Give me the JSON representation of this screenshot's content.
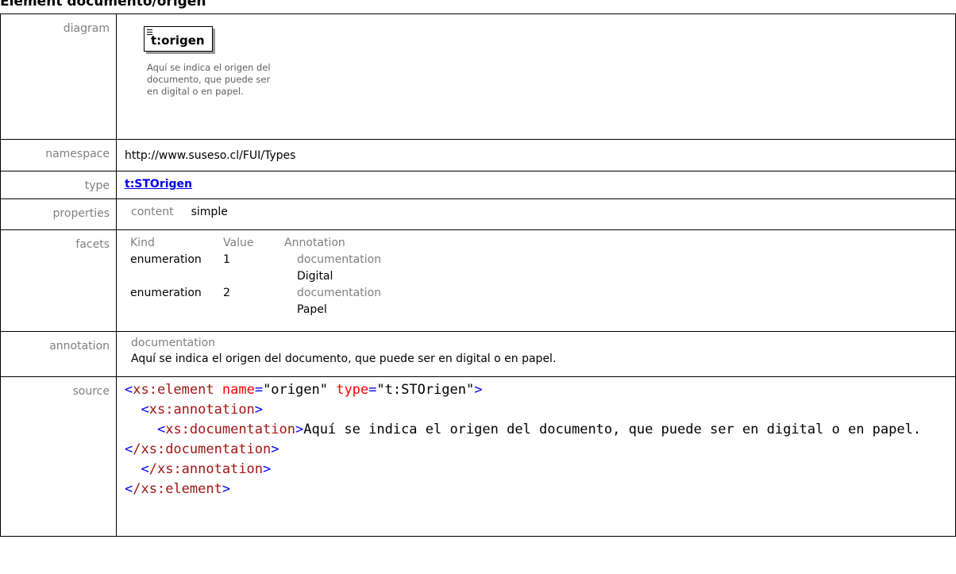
{
  "heading": "Element documento/origen",
  "labels": {
    "diagram": "diagram",
    "namespace": "namespace",
    "type": "type",
    "properties": "properties",
    "facets": "facets",
    "annotation": "annotation",
    "source": "source"
  },
  "diagram": {
    "element_name": "t:origen",
    "documentation_lines": [
      "Aquí se indica el origen del",
      "documento, que puede ser",
      "en digital o en papel."
    ]
  },
  "namespace": "http://www.suseso.cl/FUI/Types",
  "type": "t:STOrigen",
  "properties": {
    "label": "content",
    "value": "simple"
  },
  "facets": {
    "headers": [
      "Kind",
      "Value",
      "Annotation"
    ],
    "rows": [
      {
        "kind": "enumeration",
        "value": "1",
        "ann_label": "documentation",
        "ann_text": "Digital"
      },
      {
        "kind": "enumeration",
        "value": "2",
        "ann_label": "documentation",
        "ann_text": "Papel"
      }
    ]
  },
  "annotation": {
    "label": "documentation",
    "text": "Aquí se indica el origen del documento, que puede ser en digital o en papel."
  },
  "source": {
    "element_open": "xs:element",
    "attr_name": "name",
    "attr_name_value": "\"origen\"",
    "attr_type": "type",
    "attr_type_value": "\"t:STOrigen\"",
    "annotation_tag": "xs:annotation",
    "documentation_tag": "xs:documentation",
    "documentation_text": "Aquí se indica el origen del documento, que puede ser en digital o en papel.",
    "close_documentation": "/xs:documentation",
    "close_annotation": "/xs:annotation",
    "close_element": "/xs:element"
  },
  "colors": {
    "label_gray": "#7f7f7f",
    "link": "#0000ee",
    "xml_tag": "#a31515",
    "xml_attr": "#ff0000",
    "xml_punct": "#0000ff"
  }
}
